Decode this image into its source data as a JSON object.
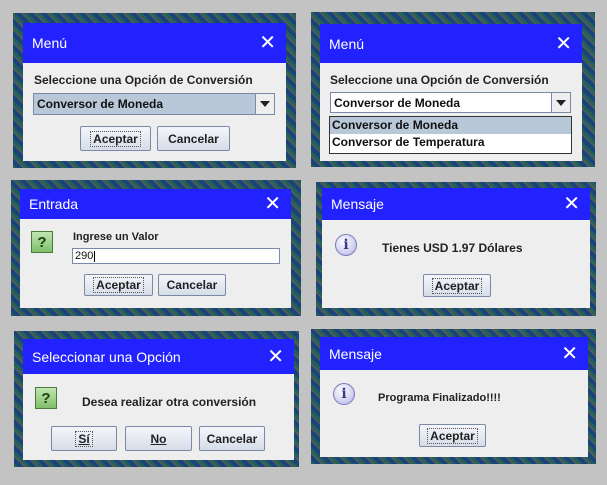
{
  "d1": {
    "title": "Menú",
    "close": "✕",
    "prompt": "Seleccione una Opción de Conversión",
    "selected": "Conversor de Moneda",
    "ok": "Aceptar",
    "cancel": "Cancelar"
  },
  "d2": {
    "title": "Menú",
    "close": "✕",
    "prompt": "Seleccione una Opción de Conversión",
    "selected": "Conversor de Moneda",
    "options": [
      "Conversor de Moneda",
      "Conversor de Temperatura"
    ]
  },
  "d3": {
    "title": "Entrada",
    "close": "✕",
    "icon": "?",
    "prompt": "Ingrese un Valor",
    "value": "290",
    "ok": "Aceptar",
    "cancel": "Cancelar"
  },
  "d4": {
    "title": "Mensaje",
    "close": "✕",
    "icon": "i",
    "message": "Tienes USD 1.97 Dólares",
    "ok": "Aceptar"
  },
  "d5": {
    "title": "Seleccionar una Opción",
    "close": "✕",
    "icon": "?",
    "message": "Desea realizar otra conversión",
    "yes": "Sí",
    "no": "No",
    "cancel": "Cancelar"
  },
  "d6": {
    "title": "Mensaje",
    "close": "✕",
    "icon": "i",
    "message": "Programa Finalizado!!!!",
    "ok": "Aceptar"
  },
  "colors": {
    "titlebar": "#2222ff",
    "dialog": "#eeeeee",
    "selection": "#b9c8d9"
  }
}
